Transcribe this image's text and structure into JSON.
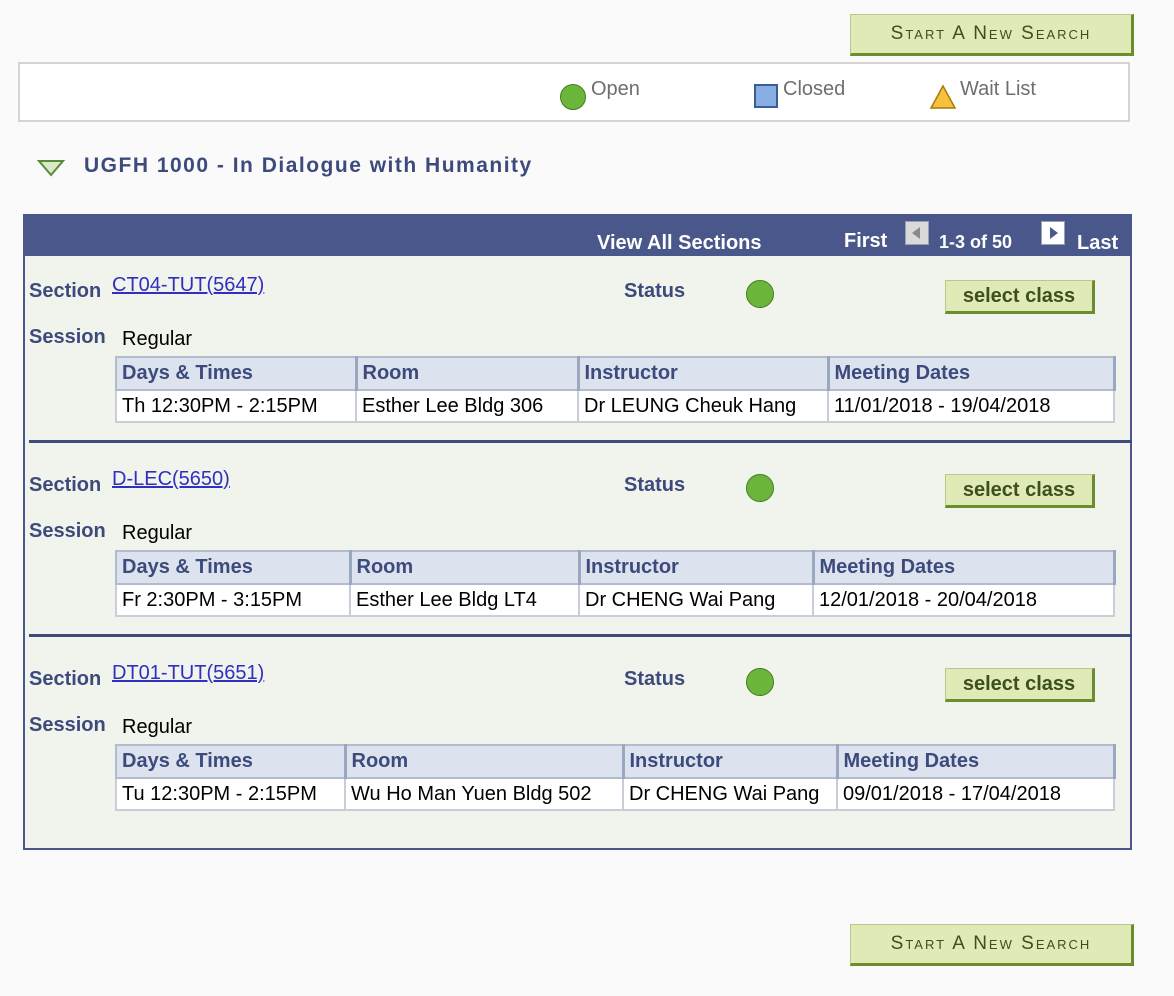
{
  "buttons": {
    "new_search_top": "Start A New Search",
    "new_search_bottom": "Start A New Search"
  },
  "legend": {
    "open": "Open",
    "closed": "Closed",
    "wait_list": "Wait List"
  },
  "course": {
    "title": "UGFH 1000 - In Dialogue with Humanity"
  },
  "nav": {
    "view_all": "View All Sections",
    "first": "First",
    "range": "1-3 of 50",
    "last": "Last"
  },
  "labels": {
    "section": "Section",
    "session": "Session",
    "status": "Status",
    "select_class": "select class",
    "col_days": "Days & Times",
    "col_room": "Room",
    "col_instructor": "Instructor",
    "col_dates": "Meeting Dates"
  },
  "sections": [
    {
      "id": "CT04-TUT(5647)",
      "status": "Open",
      "session": "Regular",
      "days_times": "Th 12:30PM - 2:15PM",
      "room": "Esther Lee Bldg 306",
      "instructor": "Dr LEUNG Cheuk Hang",
      "meeting_dates": "11/01/2018 - 19/04/2018"
    },
    {
      "id": "D-LEC(5650)",
      "status": "Open",
      "session": "Regular",
      "days_times": "Fr 2:30PM - 3:15PM",
      "room": "Esther Lee Bldg LT4",
      "instructor": "Dr CHENG Wai Pang",
      "meeting_dates": "12/01/2018 - 20/04/2018"
    },
    {
      "id": "DT01-TUT(5651)",
      "status": "Open",
      "session": "Regular",
      "days_times": "Tu 12:30PM - 2:15PM",
      "room": "Wu Ho Man Yuen Bldg 502",
      "instructor": "Dr CHENG Wai Pang",
      "meeting_dates": "09/01/2018 - 17/04/2018"
    }
  ],
  "colors": {
    "header_bar": "#4a578b",
    "heading_text": "#3d4a7c",
    "open_status": "#6bb63a",
    "button_bg": "#dfeab6",
    "link": "#3030c0"
  }
}
